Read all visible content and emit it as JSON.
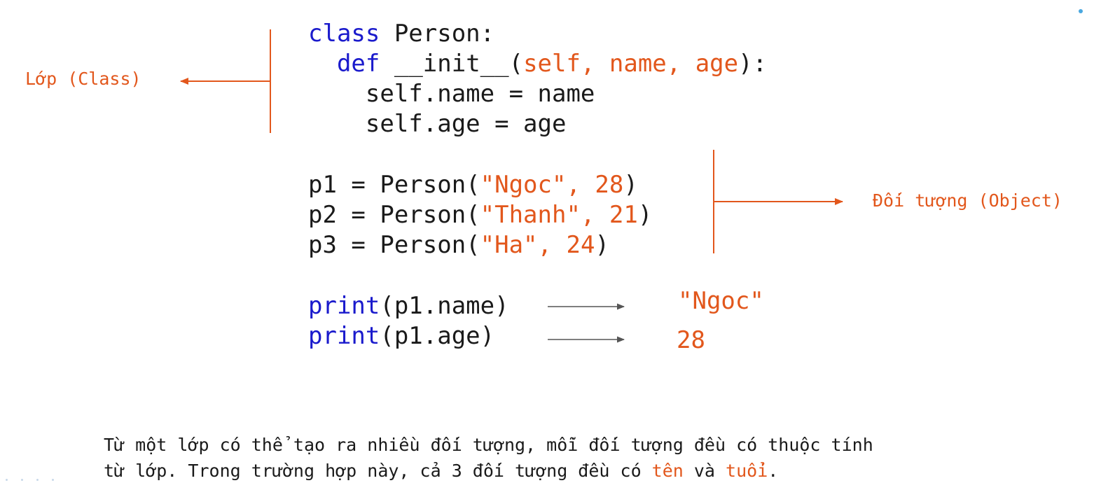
{
  "code": {
    "line1": {
      "kw": "class",
      "rest": " Person:"
    },
    "line2": {
      "indent": "  ",
      "kw": "def",
      "mid": " __init__(",
      "params": "self, name, age",
      "end": "):"
    },
    "line3": "    self.name = name",
    "line4": "    self.age = age",
    "line5": {
      "pre": "p1 = Person(",
      "str": "\"Ngoc\"",
      "comma": ", ",
      "num": "28",
      "end": ")"
    },
    "line6": {
      "pre": "p2 = Person(",
      "str": "\"Thanh\"",
      "comma": ", ",
      "num": "21",
      "end": ")"
    },
    "line7": {
      "pre": "p3 = Person(",
      "str": "\"Ha\"",
      "comma": ", ",
      "num": "24",
      "end": ")"
    },
    "line8": {
      "kw": "print",
      "rest": "(p1.name)"
    },
    "line9": {
      "kw": "print",
      "rest": "(p1.age)"
    }
  },
  "annotations": {
    "class_label": "Lớp (Class)",
    "object_label": "Đối tượng (Object)"
  },
  "results": {
    "name_output": "\"Ngoc\"",
    "age_output": "28"
  },
  "caption": {
    "line1": "Từ một lớp có thể tạo ra nhiều đối tượng, mỗi đối tượng đều có thuộc tính",
    "line2_pre": "từ lớp. Trong trường hợp này, cả 3 đối tượng đều có ",
    "highlight1": "tên",
    "line2_mid": " và ",
    "highlight2": "tuổi",
    "line2_end": "."
  },
  "colors": {
    "keyword": "#1a1acc",
    "accent": "#e2571c",
    "text": "#1a1a1a",
    "arrow_gray": "#555555"
  }
}
